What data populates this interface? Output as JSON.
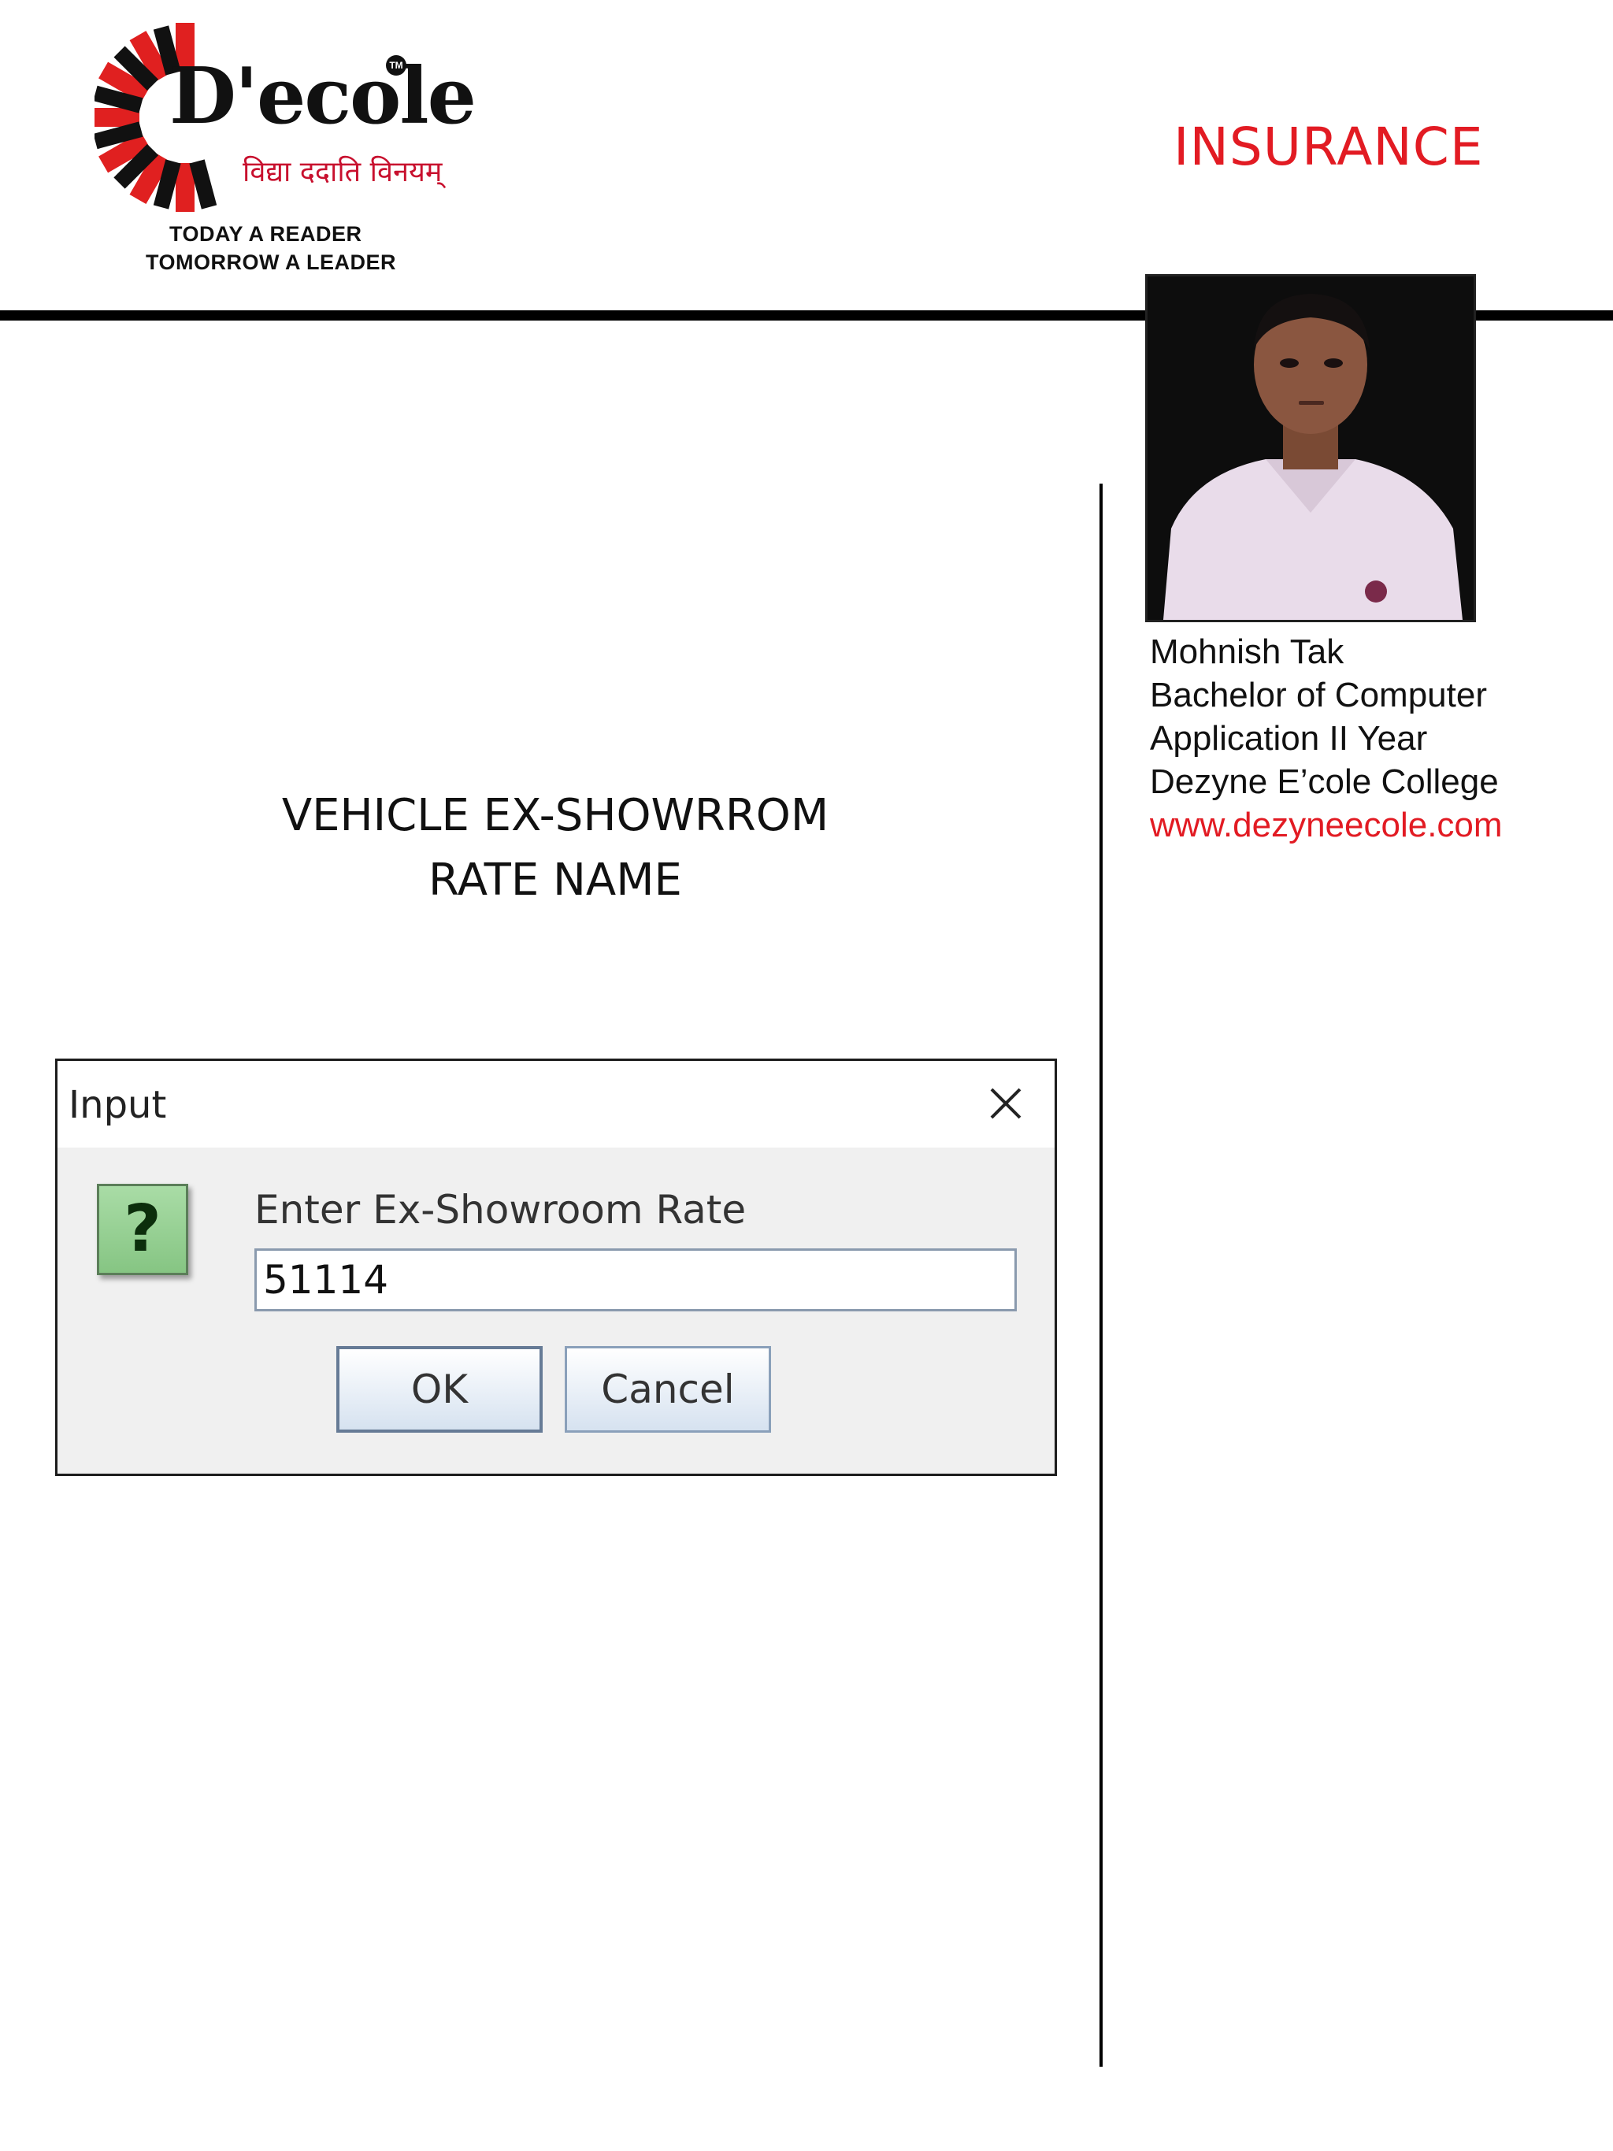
{
  "logo": {
    "brand": "D'ecole",
    "trademark": "TM",
    "motto_hindi": "विद्या ददाति विनयम्",
    "tagline_1": "TODAY A READER",
    "tagline_2": "TOMORROW A LEADER"
  },
  "header": {
    "title": "INSURANCE"
  },
  "profile": {
    "name": "Mohnish Tak",
    "course_line1": "Bachelor of Computer",
    "course_line2": "Application II Year",
    "college": "Dezyne E’cole College",
    "website": "www.dezyneecole.com"
  },
  "caption": {
    "line1": "VEHICLE EX-SHOWRROM",
    "line2": "RATE NAME"
  },
  "dialog": {
    "title": "Input",
    "prompt": "Enter Ex-Showroom Rate",
    "input_value": "51114",
    "ok_label": "OK",
    "cancel_label": "Cancel",
    "icon": "question-icon",
    "icon_glyph": "?"
  },
  "colors": {
    "accent_red": "#e21b23",
    "question_icon_green": "#86c583"
  }
}
